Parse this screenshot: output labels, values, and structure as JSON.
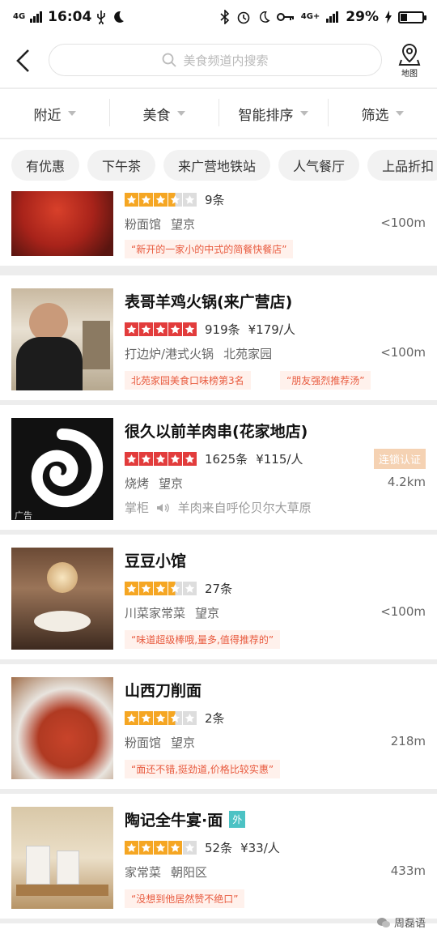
{
  "status_bar": {
    "signal_left": "4G",
    "time": "16:04",
    "signal_right": "4G+",
    "battery": "29%"
  },
  "header": {
    "search_placeholder": "美食频道内搜索",
    "map_label": "地图"
  },
  "filters": [
    "附近",
    "美食",
    "智能排序",
    "筛选"
  ],
  "tags": [
    "有优惠",
    "下午茶",
    "来广营地铁站",
    "人气餐厅",
    "上品折扣"
  ],
  "restaurants": [
    {
      "name": "",
      "stars": 3.5,
      "reviews": "9条",
      "price": "",
      "category": "粉面馆",
      "area": "望京",
      "distance": "<100m",
      "quotes": [
        "“新开的一家小的中式的简餐快餐店”"
      ]
    },
    {
      "name": "表哥羊鸡火锅(来广营店)",
      "stars": 5,
      "reviews": "919条",
      "price": "¥179/人",
      "category": "打边炉/港式火锅",
      "area": "北苑家园",
      "distance": "<100m",
      "quotes": [
        "北苑家园美食口味榜第3名",
        "“朋友强烈推荐汤”"
      ]
    },
    {
      "name": "很久以前羊肉串(花家地店)",
      "stars": 5,
      "reviews": "1625条",
      "price": "¥115/人",
      "category": "烧烤",
      "area": "望京",
      "distance": "4.2km",
      "badge": "连锁认证",
      "ad_label": "广告",
      "shopkeeper": "掌柜",
      "shopkeeper_note": "羊肉来自呼伦贝尔大草原"
    },
    {
      "name": "豆豆小馆",
      "stars": 3.5,
      "reviews": "27条",
      "price": "",
      "category": "川菜家常菜",
      "area": "望京",
      "distance": "<100m",
      "quotes": [
        "“味道超级棒哦,量多,值得推荐的”"
      ]
    },
    {
      "name": "山西刀削面",
      "stars": 3.5,
      "reviews": "2条",
      "price": "",
      "category": "粉面馆",
      "area": "望京",
      "distance": "218m",
      "quotes": [
        "“面还不错,挺劲道,价格比较实惠”"
      ]
    },
    {
      "name": "陶记全牛宴·面",
      "waimai": "外",
      "stars": 4,
      "reviews": "52条",
      "price": "¥33/人",
      "category": "家常菜",
      "area": "朝阳区",
      "distance": "433m",
      "quotes": [
        "“没想到他居然赞不绝口”"
      ]
    }
  ],
  "watermark": "周磊语",
  "colors": {
    "star_red": "#e23c3c",
    "star_yellow": "#f5a623",
    "quote_text": "#e85a3e",
    "waimai_badge": "#4cc2c4"
  }
}
